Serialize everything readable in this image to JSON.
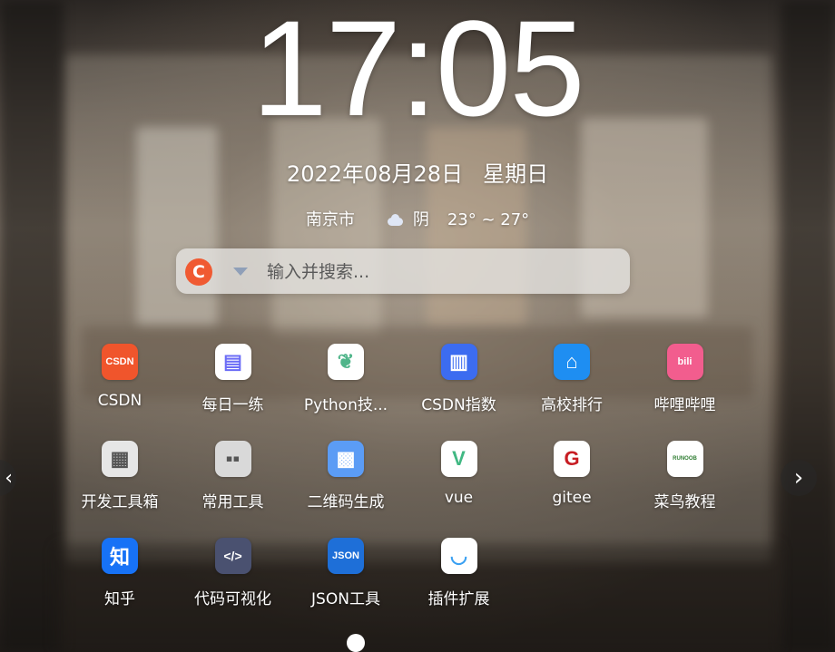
{
  "clock": {
    "time": "17:05"
  },
  "date": {
    "date_text": "2022年08月28日",
    "weekday": "星期日"
  },
  "weather": {
    "city": "南京市",
    "condition": "阴",
    "temperature": "23° ~ 27°",
    "icon": "cloud-icon"
  },
  "search": {
    "engine_icon": "csdn-logo-icon",
    "engine_letter": "C",
    "placeholder": "输入并搜索..."
  },
  "apps": [
    {
      "label": "CSDN",
      "icon": "csdn-icon",
      "glyph": "CSDN",
      "bg": "#f0552c",
      "fg": "#ffffff"
    },
    {
      "label": "每日一练",
      "icon": "daily-practice-icon",
      "glyph": "▤",
      "bg": "#ffffff",
      "fg": "#6b6cf6"
    },
    {
      "label": "Python技...",
      "icon": "python-skill-tree-icon",
      "glyph": "❦",
      "bg": "#ffffff",
      "fg": "#4fb58a"
    },
    {
      "label": "CSDN指数",
      "icon": "csdn-index-icon",
      "glyph": "▥",
      "bg": "#3c6cf0",
      "fg": "#ffffff"
    },
    {
      "label": "高校排行",
      "icon": "university-ranking-icon",
      "glyph": "⌂",
      "bg": "#1e8ef2",
      "fg": "#ffffff"
    },
    {
      "label": "哔哩哔哩",
      "icon": "bilibili-icon",
      "glyph": "bili",
      "bg": "#f25d8e",
      "fg": "#ffffff"
    },
    {
      "label": "开发工具箱",
      "icon": "dev-toolbox-icon",
      "glyph": "▦",
      "bg": "#e6e6e6",
      "fg": "#555555"
    },
    {
      "label": "常用工具",
      "icon": "common-tools-icon",
      "glyph": "▪▪",
      "bg": "#d9d9d9",
      "fg": "#555555"
    },
    {
      "label": "二维码生成",
      "icon": "qr-code-icon",
      "glyph": "▩",
      "bg": "#5b9cf5",
      "fg": "#ffffff"
    },
    {
      "label": "vue",
      "icon": "vue-icon",
      "glyph": "V",
      "bg": "#ffffff",
      "fg": "#41b883"
    },
    {
      "label": "gitee",
      "icon": "gitee-icon",
      "glyph": "G",
      "bg": "#ffffff",
      "fg": "#c71d23"
    },
    {
      "label": "菜鸟教程",
      "icon": "runoob-icon",
      "glyph": "RUNOOB",
      "bg": "#ffffff",
      "fg": "#2f7d32"
    },
    {
      "label": "知乎",
      "icon": "zhihu-icon",
      "glyph": "知",
      "bg": "#1772f6",
      "fg": "#ffffff"
    },
    {
      "label": "代码可视化",
      "icon": "code-visualization-icon",
      "glyph": "</>",
      "bg": "#4a5170",
      "fg": "#ffffff"
    },
    {
      "label": "JSON工具",
      "icon": "json-tool-icon",
      "glyph": "JSON",
      "bg": "#1e6fd8",
      "fg": "#ffffff"
    },
    {
      "label": "插件扩展",
      "icon": "plugin-extension-icon",
      "glyph": "◡",
      "bg": "#ffffff",
      "fg": "#3aa0f2"
    }
  ],
  "nav": {
    "next_icon": "chevron-right-icon",
    "prev_icon": "chevron-left-icon",
    "page_indicator": "page-dot-icon"
  }
}
